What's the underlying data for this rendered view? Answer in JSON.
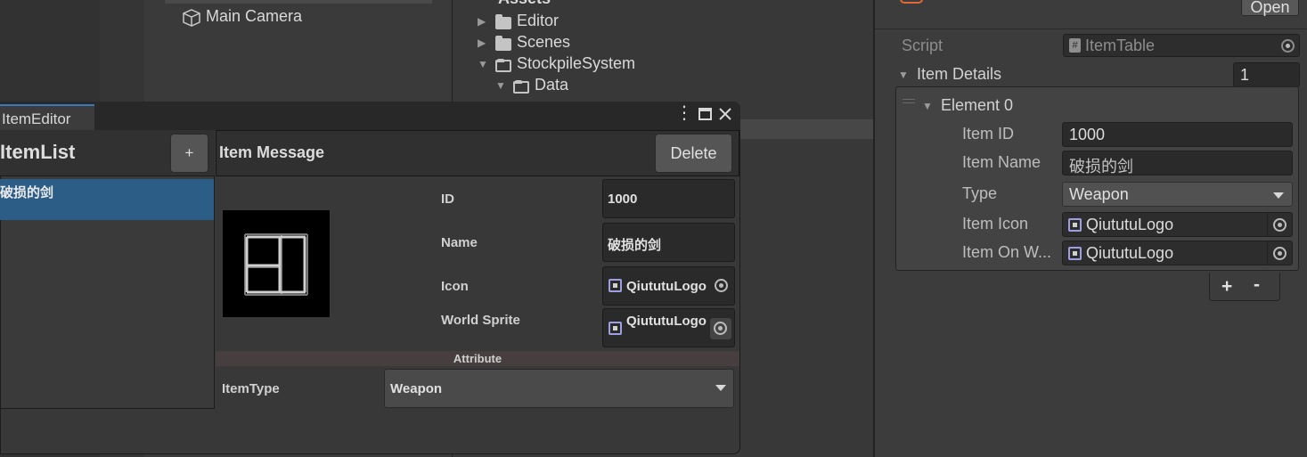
{
  "hierarchy": {
    "items": [
      {
        "label": "Main Camera",
        "icon": "cube-icon"
      }
    ]
  },
  "project": {
    "root_label": "Assets",
    "folders": [
      {
        "label": "Editor",
        "expanded": false
      },
      {
        "label": "Scenes",
        "expanded": false
      },
      {
        "label": "StockpileSystem",
        "expanded": true
      },
      {
        "label": "Data",
        "expanded": true
      }
    ]
  },
  "inspector": {
    "open_button": "Open",
    "script_label": "Script",
    "script_value": "ItemTable",
    "item_details_label": "Item Details",
    "item_details_count": "1",
    "element_label": "Element 0",
    "fields": {
      "item_id_label": "Item ID",
      "item_id_value": "1000",
      "item_name_label": "Item Name",
      "item_name_value": "破损的剑",
      "type_label": "Type",
      "type_value": "Weapon",
      "item_icon_label": "Item Icon",
      "item_icon_value": "QiututuLogo",
      "item_on_world_label": "Item On W...",
      "item_on_world_value": "QiututuLogo"
    },
    "add_button": "+",
    "remove_button": "-"
  },
  "editor": {
    "tab_title": "ItemEditor",
    "list_title": "ItemList",
    "add_button": "+",
    "list_items": [
      "破损的剑"
    ],
    "message_title": "Item Message",
    "delete_button": "Delete",
    "id_label": "ID",
    "id_value": "1000",
    "name_label": "Name",
    "name_value": "破损的剑",
    "icon_label": "Icon",
    "icon_value": "QiututuLogo",
    "world_sprite_label": "World Sprite",
    "world_sprite_value": "QiututuLogo",
    "attribute_header": "Attribute",
    "item_type_label": "ItemType",
    "item_type_value": "Weapon"
  },
  "colors": {
    "selection": "#2c5d87",
    "tab_accent": "#3a79bb",
    "attribute_bar": "#473f3f"
  }
}
